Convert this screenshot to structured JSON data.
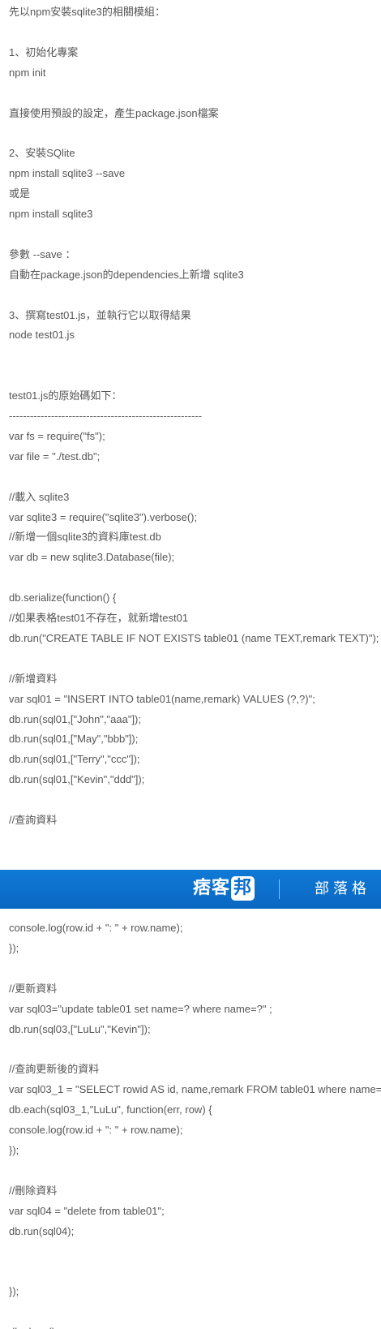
{
  "colors": {
    "text": "#555555",
    "banner": "#0b6ecb",
    "banner_text": "#ffffff"
  },
  "article": {
    "lines": [
      "先以npm安裝sqlite3的相關模組：",
      "",
      "1、初始化專案",
      "npm init",
      "",
      "直接使用預設的設定，產生package.json檔案",
      "",
      "2、安裝SQlite",
      "npm install sqlite3 --save",
      "或是",
      "npm install sqlite3",
      "",
      "參數 --save ：",
      "自動在package.json的dependencies上新增 sqlite3",
      "",
      "3、撰寫test01.js，並執行它以取得結果",
      "node test01.js",
      "",
      "",
      "test01.js的原始碼如下：",
      "-------------------------------------------------------",
      "var fs = require(\"fs\");",
      "var file = \"./test.db\";",
      "",
      "//載入 sqlite3",
      "var sqlite3 = require(\"sqlite3\").verbose();",
      "//新增一個sqlite3的資料庫test.db",
      "var db = new sqlite3.Database(file);",
      "",
      "db.serialize(function() {",
      "//如果表格test01不存在，就新增test01",
      "db.run(\"CREATE TABLE IF NOT EXISTS table01 (name TEXT,remark TEXT)\");",
      "",
      "//新增資料",
      "var sql01 = \"INSERT INTO table01(name,remark) VALUES (?,?)\";",
      "db.run(sql01,[\"John\",\"aaa\"]);",
      "db.run(sql01,[\"May\",\"bbb\"]);",
      "db.run(sql01,[\"Terry\",\"ccc\"]);",
      "db.run(sql01,[\"Kevin\",\"ddd\"]);",
      "",
      "//查詢資料"
    ],
    "lines_after_banner": [
      "console.log(row.id + \": \" + row.name);",
      "});",
      "",
      "//更新資料",
      "var sql03=\"update table01 set name=? where name=?\" ;",
      "db.run(sql03,[\"LuLu\",\"Kevin\"]);",
      "",
      "//查詢更新後的資料",
      "var sql03_1 = \"SELECT rowid AS id, name,remark FROM table01 where name=",
      "db.each(sql03_1,\"LuLu\", function(err, row) {",
      "console.log(row.id + \": \" + row.name);",
      "});",
      "",
      "//刪除資料",
      "var sql04 = \"delete from table01\";",
      "db.run(sql04);",
      "",
      "",
      "});",
      "",
      "db.close();"
    ]
  },
  "banner": {
    "logo_main": "痞客",
    "logo_badge": "邦",
    "label": "部落格"
  }
}
